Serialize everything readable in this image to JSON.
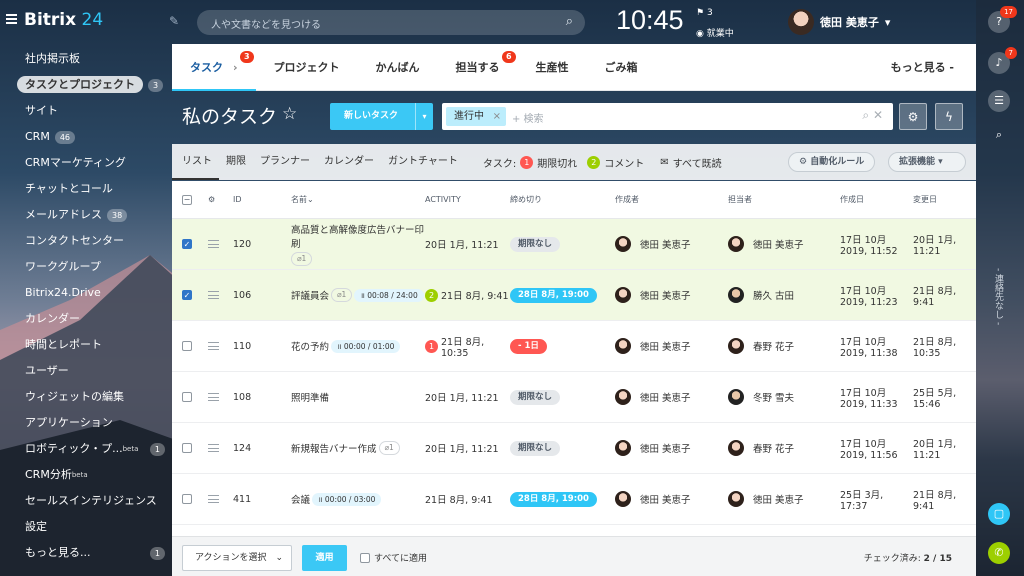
{
  "topbar": {
    "logo_main": "Bitrix",
    "logo_num": "24",
    "search_placeholder": "人や文書などを見つける",
    "clock": "10:45",
    "flag_count": "3",
    "work_status": "就業中",
    "user_name": "徳田 美恵子"
  },
  "left_menu": [
    {
      "label": "社内掲示板",
      "count": ""
    },
    {
      "label": "タスクとプロジェクト",
      "count": "3",
      "active": true
    },
    {
      "label": "サイト",
      "count": ""
    },
    {
      "label": "CRM",
      "count": "46"
    },
    {
      "label": "CRMマーケティング",
      "count": ""
    },
    {
      "label": "チャットとコール",
      "count": ""
    },
    {
      "label": "メールアドレス",
      "count": "38"
    },
    {
      "label": "コンタクトセンター",
      "count": ""
    },
    {
      "label": "ワークグループ",
      "count": ""
    },
    {
      "label": "Bitrix24.Drive",
      "count": ""
    },
    {
      "label": "カレンダー",
      "count": ""
    },
    {
      "label": "時間とレポート",
      "count": ""
    },
    {
      "label": "ユーザー",
      "count": ""
    },
    {
      "label": "ウィジェットの編集",
      "count": ""
    },
    {
      "label": "アプリケーション",
      "count": ""
    },
    {
      "label": "ロボティック・プ...",
      "sup": "beta",
      "count": "1"
    },
    {
      "label": "CRM分析",
      "sup": "beta",
      "count": ""
    },
    {
      "label": "セールスインテリジェンス",
      "count": ""
    },
    {
      "label": "設定",
      "count": ""
    },
    {
      "label": "もっと見る...",
      "count": "1"
    }
  ],
  "right_bar": {
    "help_badge": "17",
    "bell_badge": "7",
    "vertical_text": "- 連絡先なし -"
  },
  "tabs": [
    {
      "label": "タスク",
      "badge": "3",
      "active": true
    },
    {
      "label": "プロジェクト",
      "badge": ""
    },
    {
      "label": "かんばん",
      "badge": ""
    },
    {
      "label": "担当する",
      "badge": "6"
    },
    {
      "label": "生産性",
      "badge": ""
    },
    {
      "label": "ごみ箱",
      "badge": ""
    }
  ],
  "tabs_more": "もっと見る -",
  "page_title": "私のタスク",
  "new_task_label": "新しいタスク",
  "filter": {
    "chip": "進行中",
    "placeholder": "+ 検索"
  },
  "views": [
    "リスト",
    "期限",
    "プランナー",
    "カレンダー",
    "ガントチャート"
  ],
  "task_counters": {
    "label": "タスク:",
    "overdue_count": "1",
    "overdue_label": "期限切れ",
    "comment_count": "2",
    "comment_label": "コメント",
    "read_all": "すべて既読"
  },
  "automation_label": "自動化ルール",
  "extensions_label": "拡張機能",
  "columns": {
    "id": "ID",
    "name": "名前",
    "activity": "ACTIVITY",
    "deadline": "締め切り",
    "creator": "作成者",
    "responsible": "担当者",
    "created": "作成日",
    "changed": "変更日"
  },
  "rows": [
    {
      "checked": true,
      "id": "120",
      "name": "高品質と高解像度広告バナー印刷",
      "attach": "1",
      "timer": "",
      "activity_badge": "",
      "activity": "20日 1月, 11:21",
      "deadline": "期限なし",
      "deadline_type": "none",
      "creator": "徳田 美恵子",
      "responsible": "徳田 美恵子",
      "created": "17日 10月 2019, 11:52",
      "changed": "20日 1月, 11:21"
    },
    {
      "checked": true,
      "id": "106",
      "name": "評議員会",
      "attach": "1",
      "timer": "00:08 / 24:00",
      "activity_badge": "2",
      "activity": "21日 8月, 9:41",
      "deadline": "28日 8月, 19:00",
      "deadline_type": "blue",
      "creator": "徳田 美恵子",
      "responsible": "勝久 古田",
      "created": "17日 10月 2019, 11:23",
      "changed": "21日 8月, 9:41"
    },
    {
      "checked": false,
      "id": "110",
      "name": "花の予約",
      "attach": "",
      "timer": "00:00 / 01:00",
      "activity_badge": "1",
      "activity": "21日 8月, 10:35",
      "deadline": "- 1日",
      "deadline_type": "red",
      "creator": "徳田 美恵子",
      "responsible": "春野 花子",
      "created": "17日 10月 2019, 11:38",
      "changed": "21日 8月, 10:35"
    },
    {
      "checked": false,
      "id": "108",
      "name": "照明準備",
      "attach": "",
      "timer": "",
      "activity_badge": "",
      "activity": "20日 1月, 11:21",
      "deadline": "期限なし",
      "deadline_type": "none",
      "creator": "徳田 美恵子",
      "responsible": "冬野 雪夫",
      "created": "17日 10月 2019, 11:33",
      "changed": "25日 5月, 15:46"
    },
    {
      "checked": false,
      "id": "124",
      "name": "新規報告バナー作成",
      "attach": "1",
      "timer": "",
      "activity_badge": "",
      "activity": "20日 1月, 11:21",
      "deadline": "期限なし",
      "deadline_type": "none",
      "creator": "徳田 美恵子",
      "responsible": "春野 花子",
      "created": "17日 10月 2019, 11:56",
      "changed": "20日 1月, 11:21"
    },
    {
      "checked": false,
      "id": "411",
      "name": "会議",
      "attach": "",
      "timer": "00:00 / 03:00",
      "activity_badge": "",
      "activity": "21日 8月, 9:41",
      "deadline": "28日 8月, 19:00",
      "deadline_type": "blue",
      "creator": "徳田 美恵子",
      "responsible": "徳田 美恵子",
      "created": "25日 3月, 17:37",
      "changed": "21日 8月, 9:41"
    }
  ],
  "bottom": {
    "action_select": "アクションを選択",
    "apply": "適用",
    "apply_all": "すべてに適用",
    "checked_label": "チェック済み:",
    "checked_value": "2 / 15"
  },
  "colors": {
    "accent": "#2fc6f6",
    "badge_red": "#f0371b",
    "overdue": "#ff5752",
    "selected_row": "#f1f9e2"
  }
}
